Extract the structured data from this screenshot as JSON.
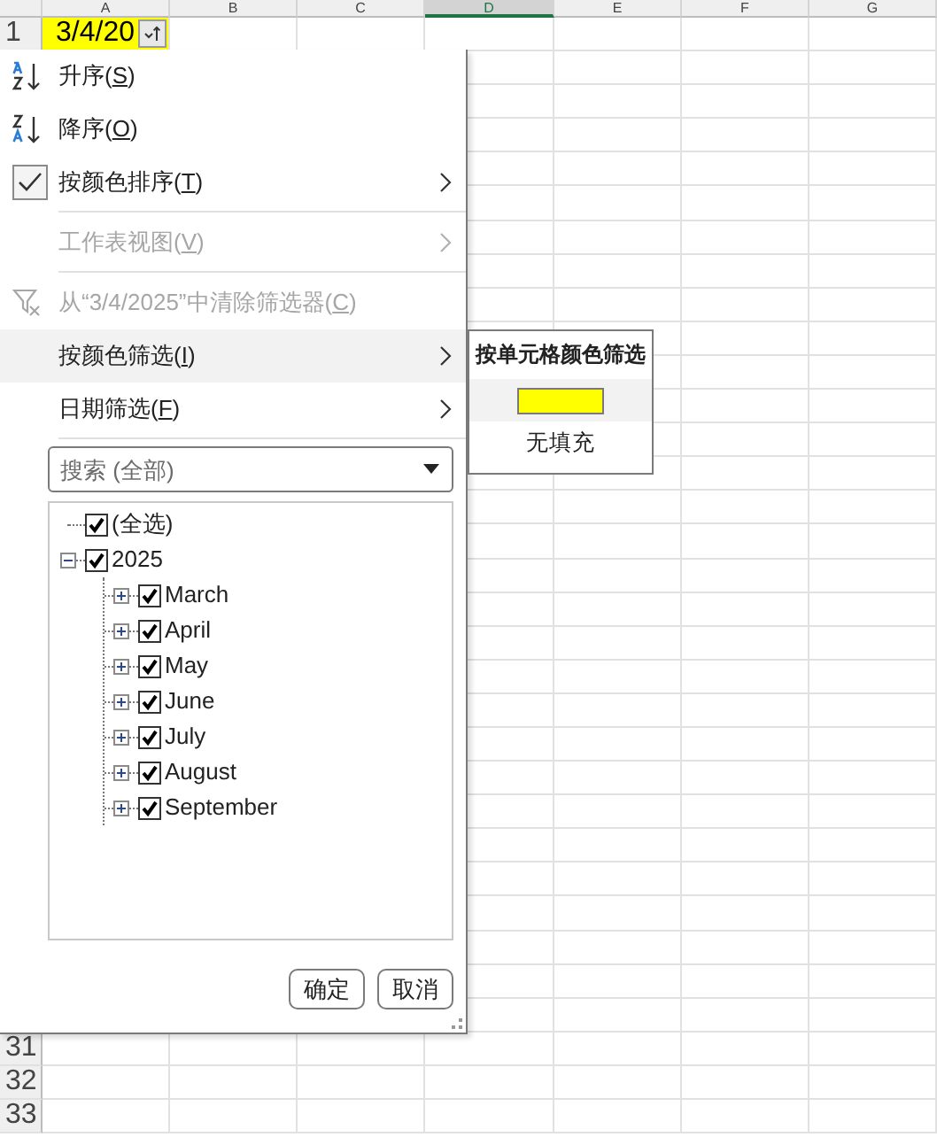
{
  "sheet": {
    "columns": [
      {
        "label": "A",
        "selected": false
      },
      {
        "label": "B",
        "selected": false
      },
      {
        "label": "C",
        "selected": false
      },
      {
        "label": "D",
        "selected": true
      },
      {
        "label": "E",
        "selected": false
      },
      {
        "label": "F",
        "selected": false
      },
      {
        "label": "G",
        "selected": false
      }
    ],
    "rows": [
      {
        "number": "1",
        "cells": [
          {
            "text": "3/4/20",
            "color": "#ffff00",
            "filter_button": true
          }
        ]
      },
      {
        "number": "31"
      },
      {
        "number": "32"
      },
      {
        "number": "33"
      }
    ]
  },
  "filter_menu": {
    "items": [
      {
        "kind": "sort-ascending",
        "label": "升序(",
        "access_key": "S",
        "label_end": ")",
        "disabled": false,
        "highlighted": false,
        "submenu": false
      },
      {
        "kind": "sort-descending",
        "label": "降序(",
        "access_key": "O",
        "label_end": ")",
        "disabled": false,
        "highlighted": false,
        "submenu": false
      },
      {
        "kind": "check",
        "label": "按颜色排序(",
        "access_key": "T",
        "label_end": ")",
        "disabled": false,
        "highlighted": false,
        "submenu": true
      },
      {
        "kind": "separator"
      },
      {
        "kind": "item",
        "label": "工作表视图(",
        "access_key": "V",
        "label_end": ")",
        "disabled": true,
        "highlighted": false,
        "submenu": true
      },
      {
        "kind": "separator"
      },
      {
        "kind": "filter-clear",
        "label": "从“3/4/2025”中清除筛选器(",
        "access_key": "C",
        "label_end": ")",
        "disabled": true,
        "highlighted": false,
        "submenu": false
      },
      {
        "kind": "item",
        "label": "按颜色筛选(",
        "access_key": "I",
        "label_end": ")",
        "disabled": false,
        "highlighted": true,
        "submenu": true
      },
      {
        "kind": "item",
        "label": "日期筛选(",
        "access_key": "F",
        "label_end": ")",
        "disabled": false,
        "highlighted": false,
        "submenu": true
      },
      {
        "kind": "separator"
      }
    ],
    "search": {
      "placeholder": "搜索 (全部)"
    },
    "tree": [
      {
        "label": "(全选)",
        "checked": true
      },
      {
        "label": "2025",
        "checked": true,
        "expanded": true,
        "children": [
          {
            "label": "March",
            "checked": true,
            "expanded": false
          },
          {
            "label": "April",
            "checked": true,
            "expanded": false
          },
          {
            "label": "May",
            "checked": true,
            "expanded": false
          },
          {
            "label": "June",
            "checked": true,
            "expanded": false
          },
          {
            "label": "July",
            "checked": true,
            "expanded": false
          },
          {
            "label": "August",
            "checked": true,
            "expanded": false
          },
          {
            "label": "September",
            "checked": true,
            "expanded": false
          }
        ]
      }
    ],
    "buttons": [
      "确定",
      "取消"
    ]
  },
  "color_submenu": {
    "title": "按单元格颜色筛选",
    "items": [
      {
        "kind": "swatch",
        "color": "#ffff00",
        "highlighted": true
      },
      {
        "kind": "text",
        "label": "无填充",
        "highlighted": false
      }
    ]
  }
}
